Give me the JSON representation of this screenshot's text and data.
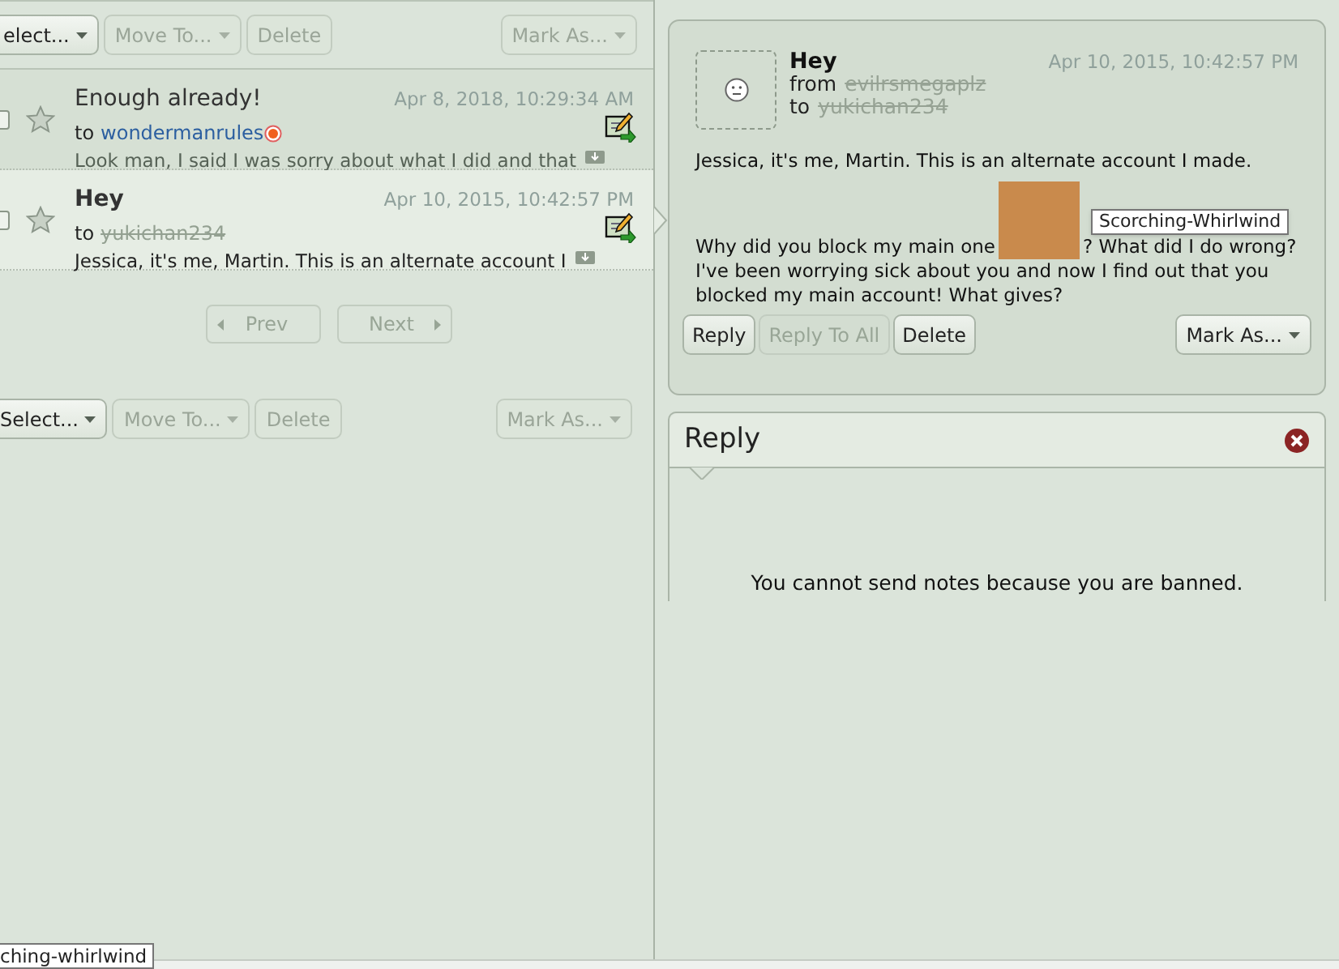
{
  "top_toolbar": {
    "buttons": [
      {
        "label": "elect...",
        "kind": "dropdown",
        "disabled": false
      },
      {
        "label": "Move To...",
        "kind": "dropdown",
        "disabled": true
      },
      {
        "label": "Delete",
        "kind": "plain",
        "disabled": true
      }
    ],
    "mark_as": {
      "label": "Mark As...",
      "disabled": true
    }
  },
  "notes": [
    {
      "title": "Enough already!",
      "unread": false,
      "selected": false,
      "date": "Apr 8, 2018, 10:29:34 AM",
      "to_label": "to",
      "recipient": "wondermanrules",
      "recipient_deleted": false,
      "preview": "Look man, I said I was sorry about what I did and that"
    },
    {
      "title": "Hey",
      "unread": true,
      "selected": true,
      "date": "Apr 10, 2015, 10:42:57 PM",
      "to_label": "to",
      "recipient": "yukichan234",
      "recipient_deleted": true,
      "preview": "Jessica, it's me, Martin. This is an alternate account I"
    }
  ],
  "pager": {
    "prev": "Prev",
    "next": "Next"
  },
  "bottom_toolbar": {
    "buttons": [
      {
        "label": "Select...",
        "kind": "dropdown",
        "disabled": false
      },
      {
        "label": "Move To...",
        "kind": "dropdown",
        "disabled": true
      },
      {
        "label": "Delete",
        "kind": "plain",
        "disabled": true
      }
    ],
    "mark_as": {
      "label": "Mark As...",
      "disabled": true
    }
  },
  "message": {
    "title": "Hey",
    "from_label": "from",
    "sender": "evilrsmegaplz",
    "to_label": "to",
    "recipient": "yukichan234",
    "date": "Apr 10, 2015, 10:42:57 PM",
    "body_1": "Jessica, it's me, Martin. This is an alternate account I made.",
    "body_2a": "Why did you block my main one",
    "body_2b": "? What did I do wrong? I've been worrying sick about you and now I find out that you blocked my main account! What gives?",
    "tooltip": "Scorching-Whirlwind",
    "buttons": [
      {
        "label": "Reply",
        "disabled": false
      },
      {
        "label": "Reply To All",
        "disabled": true
      },
      {
        "label": "Delete",
        "disabled": false
      }
    ],
    "mark_as": {
      "label": "Mark As...",
      "disabled": false
    }
  },
  "reply_panel": {
    "title": "Reply",
    "notice": "You cannot send notes because you are banned."
  },
  "bottom_tooltip": "ching-whirlwind"
}
